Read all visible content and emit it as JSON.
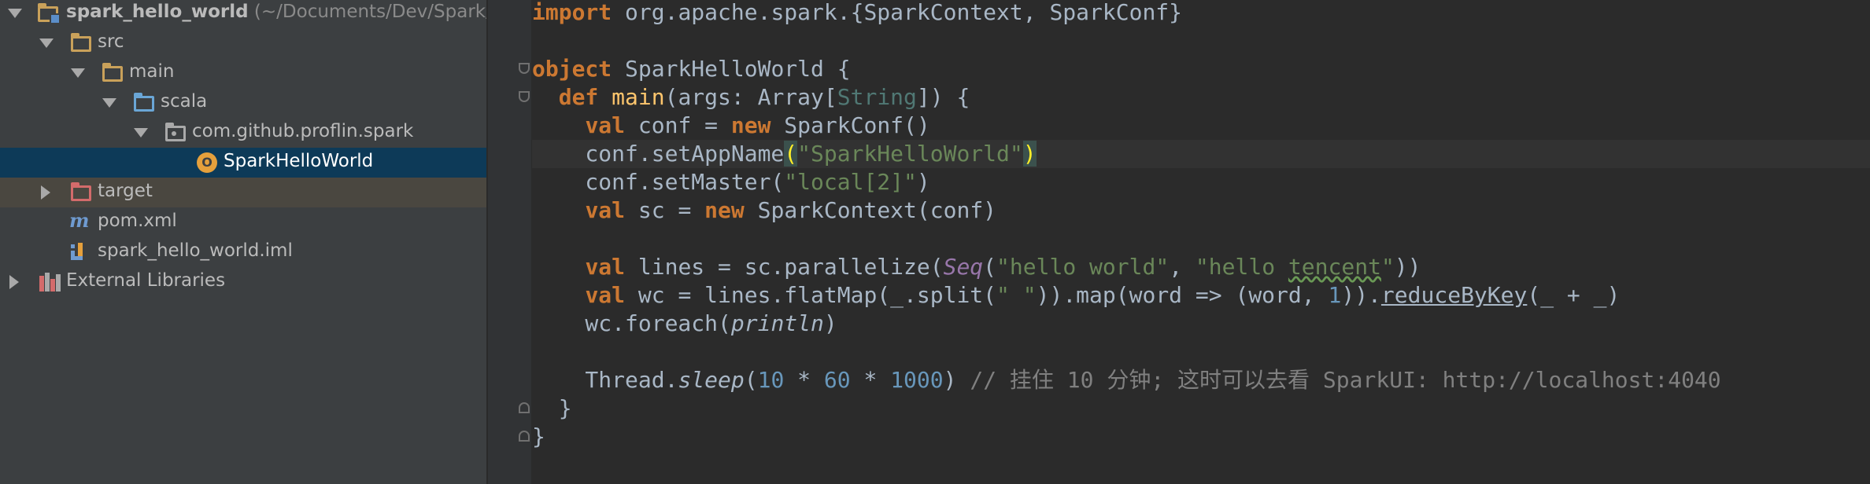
{
  "project_tree": {
    "root": {
      "label": "spark_hello_world",
      "path": "(~/Documents/Dev/Spark/"
    },
    "src": "src",
    "main": "main",
    "scala": "scala",
    "package": "com.github.proflin.spark",
    "selected_file": "SparkHelloWorld",
    "target": "target",
    "pom": "pom.xml",
    "iml": "spark_hello_world.iml",
    "external_libraries": "External Libraries",
    "object_icon_letter": "O"
  },
  "code": {
    "l1": {
      "a": "import",
      "b": " org.apache.spark.{SparkContext, SparkConf}"
    },
    "l3": {
      "a": "object",
      "b": " SparkHelloWorld {"
    },
    "l4": {
      "a": "  def ",
      "b": "main",
      "c": "(args: Array[",
      "d": "String",
      "e": "]) {"
    },
    "l5": {
      "a": "    ",
      "b": "val",
      "c": " conf = ",
      "d": "new",
      "e": " SparkConf()"
    },
    "l6": {
      "a": "    conf.",
      "b": "setAppName",
      "c": "(",
      "d": "\"SparkHelloWorld\"",
      "e": ")"
    },
    "l7": {
      "a": "    conf.setMaster(",
      "b": "\"local[2]\"",
      "c": ")"
    },
    "l8": {
      "a": "    ",
      "b": "val",
      "c": " sc = ",
      "d": "new",
      "e": " SparkContext(conf)"
    },
    "l10": {
      "a": "    ",
      "b": "val",
      "c": " lines = sc.parallelize(",
      "d": "Seq",
      "e": "(",
      "f": "\"hello world\"",
      "g": ", ",
      "h": "\"hello ",
      "i": "tencent",
      "j": "\"",
      "k": "))"
    },
    "l11": {
      "a": "    ",
      "b": "val",
      "c": " wc = lines.flatMap(_.split(",
      "d": "\" \"",
      "e": ")).map(word => (word, ",
      "f": "1",
      "g": ")).",
      "h": "reduceByKey",
      "i": "(_ + _)"
    },
    "l12": {
      "a": "    wc.foreach(",
      "b": "println",
      "c": ")"
    },
    "l14": {
      "a": "    Thread.",
      "b": "sleep",
      "c": "(",
      "d": "10",
      "e": " * ",
      "f": "60",
      "g": " * ",
      "h": "1000",
      "i": ") ",
      "j": "// 挂住 10 分钟; 这时可以去看 SparkUI: http://localhost:4040"
    },
    "l15": "  }",
    "l16": "}"
  },
  "colors": {
    "keyword": "#CC7832",
    "function": "#FFC66D",
    "string": "#6A8759",
    "number": "#6897BB",
    "comment": "#808080",
    "selection": "#0D3A58"
  }
}
